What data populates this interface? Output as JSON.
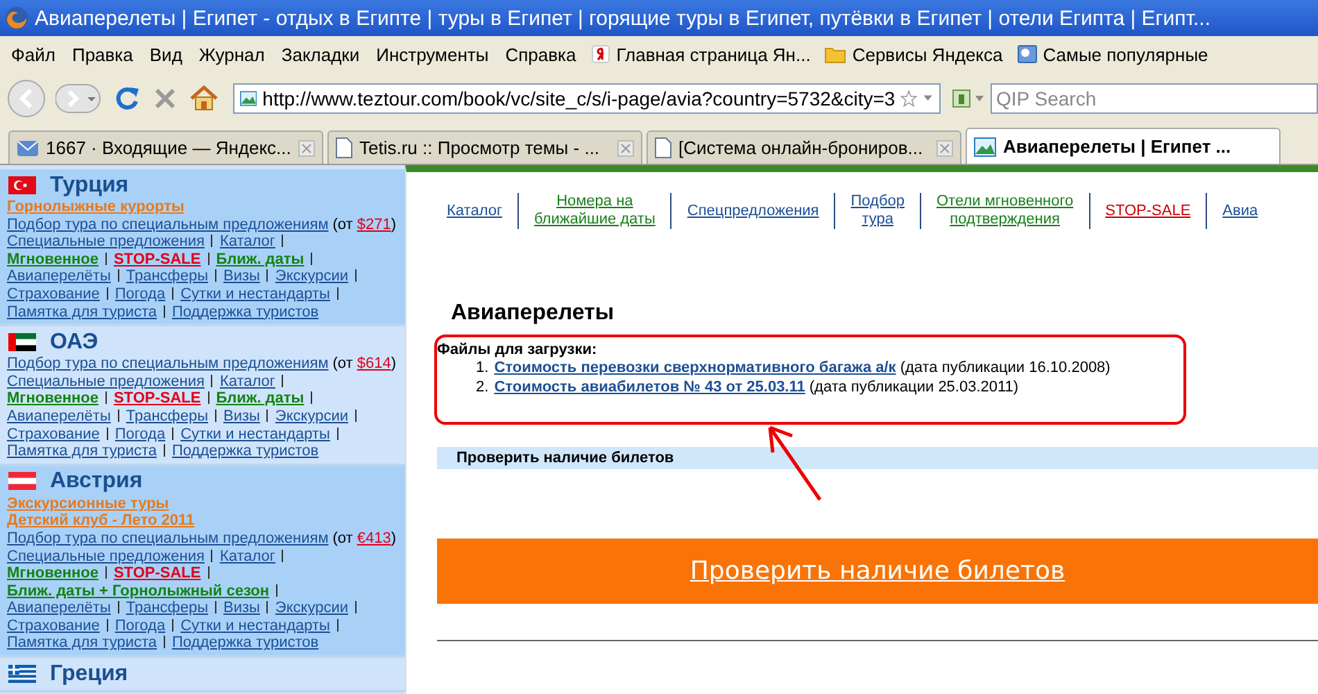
{
  "window": {
    "title": "Авиаперелеты | Египет - отдых в Египте | туры в Египет | горящие туры в Египет, путёвки в Египет | отели Египта | Египт..."
  },
  "menu": [
    "Файл",
    "Правка",
    "Вид",
    "Журнал",
    "Закладки",
    "Инструменты",
    "Справка"
  ],
  "bookmarks": [
    {
      "label": "Главная страница Ян...",
      "kind": "yandex"
    },
    {
      "label": "Сервисы Яндекса",
      "kind": "folder"
    },
    {
      "label": "Самые популярные",
      "kind": "page"
    }
  ],
  "address": {
    "value": "http://www.teztour.com/book/vc/site_c/s/i-page/avia?country=5732&city=3"
  },
  "search": {
    "placeholder": "QIP Search"
  },
  "tabs": [
    {
      "label": "1667 · Входящие — Яндекс...",
      "kind": "mail",
      "selected": false
    },
    {
      "label": "Tetis.ru :: Просмотр темы - ...",
      "kind": "page",
      "selected": false
    },
    {
      "label": "[Система онлайн-брониров...",
      "kind": "page",
      "selected": false
    },
    {
      "label": "Авиаперелеты | Египет ...",
      "kind": "site",
      "selected": true
    }
  ],
  "sidebar": {
    "countries": [
      {
        "name": "Турция",
        "kind": "turkey",
        "lines": [
          [
            {
              "kind": "promo",
              "text": "Горнолыжные курорты"
            }
          ],
          [
            {
              "kind": "link",
              "text": "Подбор тура по специальным предложениям"
            },
            {
              "kind": "price",
              "prefix": "(от",
              "price": "$271",
              "suffix": ")"
            }
          ],
          [
            {
              "kind": "link",
              "text": "Специальные предложения",
              "sep": true
            },
            {
              "kind": "link",
              "text": "Каталог",
              "sep": true
            }
          ],
          [
            {
              "kind": "instant",
              "text": "Мгновенное",
              "sep": true
            },
            {
              "kind": "stop",
              "text": "STOP-SALE",
              "sep": true
            },
            {
              "kind": "instant",
              "text": "Ближ. даты",
              "sep": true
            }
          ],
          [
            {
              "kind": "link",
              "text": "Авиаперелёты",
              "sep": true
            },
            {
              "kind": "link",
              "text": "Трансферы",
              "sep": true
            },
            {
              "kind": "link",
              "text": "Визы",
              "sep": true
            },
            {
              "kind": "link",
              "text": "Экскурсии",
              "sep": true
            }
          ],
          [
            {
              "kind": "link",
              "text": "Страхование",
              "sep": true
            },
            {
              "kind": "link",
              "text": "Погода",
              "sep": true
            },
            {
              "kind": "link",
              "text": "Сутки и нестандарты",
              "sep": true
            }
          ],
          [
            {
              "kind": "link",
              "text": "Памятка для туриста",
              "sep": true
            },
            {
              "kind": "link",
              "text": "Поддержка туристов"
            }
          ]
        ]
      },
      {
        "name": "ОАЭ",
        "kind": "uae",
        "lines": [
          [
            {
              "kind": "link",
              "text": "Подбор тура по специальным предложениям"
            },
            {
              "kind": "price",
              "prefix": "(от",
              "price": "$614",
              "suffix": ")"
            }
          ],
          [
            {
              "kind": "link",
              "text": "Специальные предложения",
              "sep": true
            },
            {
              "kind": "link",
              "text": "Каталог",
              "sep": true
            }
          ],
          [
            {
              "kind": "instant",
              "text": "Мгновенное",
              "sep": true
            },
            {
              "kind": "stop",
              "text": "STOP-SALE",
              "sep": true
            },
            {
              "kind": "instant",
              "text": "Ближ. даты",
              "sep": true
            }
          ],
          [
            {
              "kind": "link",
              "text": "Авиаперелёты",
              "sep": true
            },
            {
              "kind": "link",
              "text": "Трансферы",
              "sep": true
            },
            {
              "kind": "link",
              "text": "Визы",
              "sep": true
            },
            {
              "kind": "link",
              "text": "Экскурсии",
              "sep": true
            }
          ],
          [
            {
              "kind": "link",
              "text": "Страхование",
              "sep": true
            },
            {
              "kind": "link",
              "text": "Погода",
              "sep": true
            },
            {
              "kind": "link",
              "text": "Сутки и нестандарты",
              "sep": true
            }
          ],
          [
            {
              "kind": "link",
              "text": "Памятка для туриста",
              "sep": true
            },
            {
              "kind": "link",
              "text": "Поддержка туристов"
            }
          ]
        ]
      },
      {
        "name": "Австрия",
        "kind": "austria",
        "lines": [
          [
            {
              "kind": "promo",
              "text": "Экскурсионные туры"
            }
          ],
          [
            {
              "kind": "promo",
              "text": "Детский клуб - Лето 2011"
            }
          ],
          [
            {
              "kind": "link",
              "text": "Подбор тура по специальным предложениям"
            },
            {
              "kind": "price",
              "prefix": "(от",
              "price": "€413",
              "suffix": ")"
            }
          ],
          [
            {
              "kind": "link",
              "text": "Специальные предложения",
              "sep": true
            },
            {
              "kind": "link",
              "text": "Каталог",
              "sep": true
            }
          ],
          [
            {
              "kind": "instant",
              "text": "Мгновенное",
              "sep": true
            },
            {
              "kind": "stop",
              "text": "STOP-SALE",
              "sep": true
            }
          ],
          [
            {
              "kind": "instant",
              "text": "Ближ. даты + Горнолыжный сезон",
              "sep": true
            }
          ],
          [
            {
              "kind": "link",
              "text": "Авиаперелёты",
              "sep": true
            },
            {
              "kind": "link",
              "text": "Трансферы",
              "sep": true
            },
            {
              "kind": "link",
              "text": "Визы",
              "sep": true
            },
            {
              "kind": "link",
              "text": "Экскурсии",
              "sep": true
            }
          ],
          [
            {
              "kind": "link",
              "text": "Страхование",
              "sep": true
            },
            {
              "kind": "link",
              "text": "Погода",
              "sep": true
            },
            {
              "kind": "link",
              "text": "Сутки и нестандарты",
              "sep": true
            }
          ],
          [
            {
              "kind": "link",
              "text": "Памятка для туриста",
              "sep": true
            },
            {
              "kind": "link",
              "text": "Поддержка туристов"
            }
          ]
        ]
      },
      {
        "name": "Греция",
        "kind": "greece"
      }
    ]
  },
  "nav": [
    {
      "lines": [
        "Каталог"
      ],
      "kind": "link"
    },
    {
      "lines": [
        "Номера на",
        "ближайшие даты"
      ],
      "kind": "hot"
    },
    {
      "lines": [
        "Спецпредложения"
      ],
      "kind": "link"
    },
    {
      "lines": [
        "Подбор",
        "тура"
      ],
      "kind": "link"
    },
    {
      "lines": [
        "Отели мгновенного",
        "подтверждения"
      ],
      "kind": "hot"
    },
    {
      "lines": [
        "STOP-SALE"
      ],
      "kind": "stop"
    },
    {
      "lines": [
        "Авиа"
      ],
      "kind": "link"
    }
  ],
  "page": {
    "title": "Авиаперелеты",
    "files_heading": "Файлы для загрузки:",
    "files": [
      {
        "number": "1.",
        "link": "Стоимость перевозки сверхнормативного багажа а/к",
        "note": "(дата публикации 16.10.2008)"
      },
      {
        "number": "2.",
        "link": "Стоимость авиабилетов № 43 от 25.03.11",
        "note": "(дата публикации 25.03.2011)"
      }
    ],
    "check_bar": "Проверить наличие билетов",
    "check_button": "Проверить наличие билетов"
  }
}
